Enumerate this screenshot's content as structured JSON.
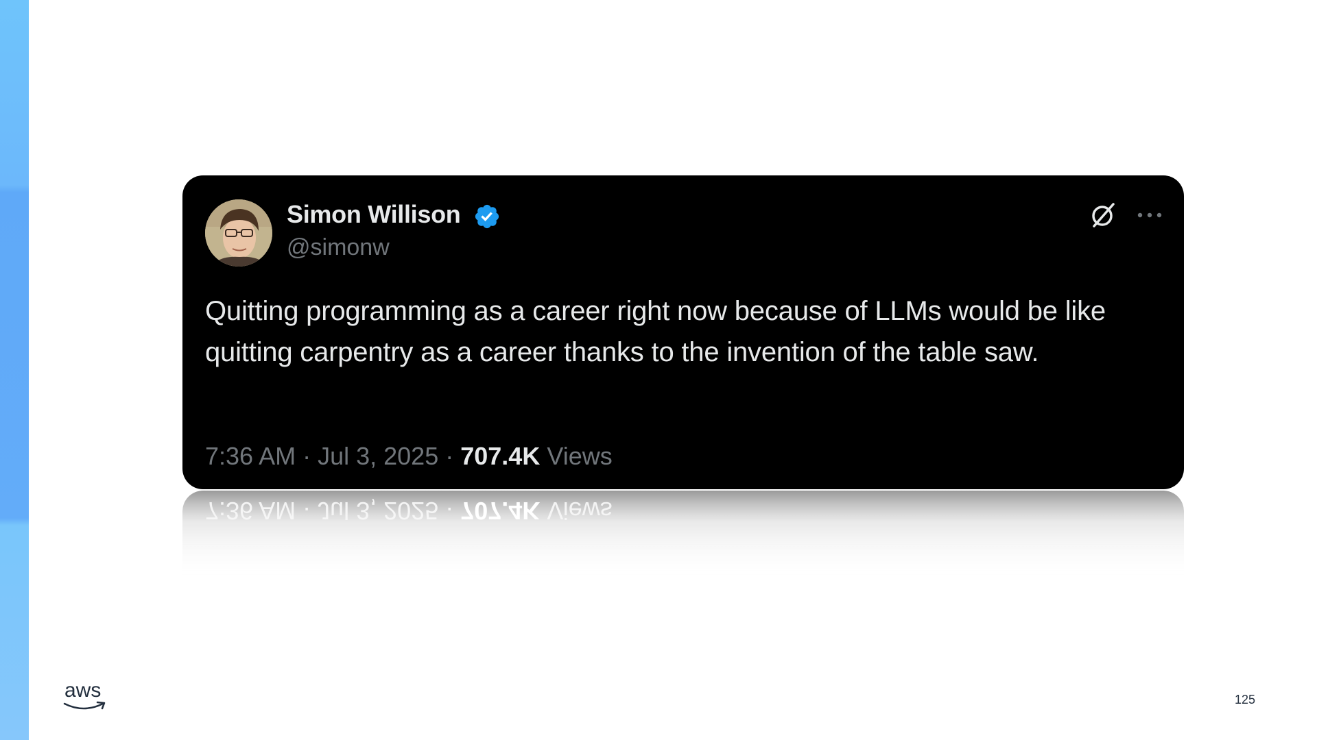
{
  "tweet": {
    "author_name": "Simon Willison",
    "handle": "@simonw",
    "text": "Quitting programming as a career right now because of LLMs would be like quitting carpentry as a career thanks to the invention of the table saw.",
    "time": "7:36 AM",
    "date": "Jul 3, 2025",
    "separator": " · ",
    "views_count": "707.4K",
    "views_label": "Views",
    "icons": {
      "verified": "verified-badge-icon",
      "grok": "grok-icon",
      "more": "more-options-icon"
    },
    "colors": {
      "card_background": "#000000",
      "primary_text": "#e7e9ea",
      "secondary_text": "#71767b",
      "verified_blue": "#1d9bf0"
    }
  },
  "slide": {
    "logo": "aws",
    "page_number": "125",
    "accent_color": "#6cb8fb"
  }
}
